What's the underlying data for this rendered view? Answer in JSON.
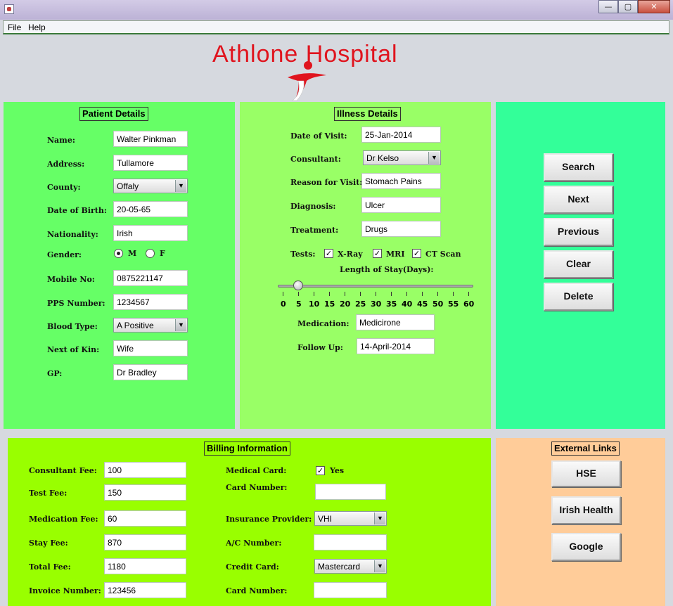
{
  "window": {
    "minimize": "—",
    "maximize": "▢",
    "close": "✕"
  },
  "menu": {
    "file": "File",
    "help": "Help"
  },
  "logo": {
    "text": "Athlone Hospital"
  },
  "patient": {
    "title": "Patient Details",
    "name_label": "Name:",
    "name_value": "Walter Pinkman",
    "address_label": "Address:",
    "address_value": "Tullamore",
    "county_label": "County:",
    "county_value": "Offaly",
    "dob_label": "Date of Birth:",
    "dob_value": "20-05-65",
    "nationality_label": "Nationality:",
    "nationality_value": "Irish",
    "gender_label": "Gender:",
    "gender_m": "M",
    "gender_f": "F",
    "mobile_label": "Mobile No:",
    "mobile_value": "0875221147",
    "pps_label": "PPS Number:",
    "pps_value": "1234567",
    "blood_label": "Blood Type:",
    "blood_value": "A Positive",
    "kin_label": "Next of Kin:",
    "kin_value": "Wife",
    "gp_label": "GP:",
    "gp_value": "Dr Bradley"
  },
  "illness": {
    "title": "Illness Details",
    "visit_label": "Date of Visit:",
    "visit_value": "25-Jan-2014",
    "consultant_label": "Consultant:",
    "consultant_value": "Dr Kelso",
    "reason_label": "Reason for Visit:",
    "reason_value": "Stomach Pains",
    "diagnosis_label": "Diagnosis:",
    "diagnosis_value": "Ulcer",
    "treatment_label": "Treatment:",
    "treatment_value": "Drugs",
    "tests_label": "Tests:",
    "test_xray": "X-Ray",
    "test_mri": "MRI",
    "test_ct": "CT Scan",
    "stay_label": "Length of Stay(Days):",
    "stay_value": 5,
    "ticks": [
      "0",
      "5",
      "10",
      "15",
      "20",
      "25",
      "30",
      "35",
      "40",
      "45",
      "50",
      "55",
      "60"
    ],
    "medication_label": "Medication:",
    "medication_value": "Medicirone",
    "followup_label": "Follow Up:",
    "followup_value": "14-April-2014"
  },
  "actions": {
    "search": "Search",
    "next": "Next",
    "previous": "Previous",
    "clear": "Clear",
    "delete": "Delete"
  },
  "billing": {
    "title": "Billing Information",
    "consultant_fee_label": "Consultant Fee:",
    "consultant_fee_value": "100",
    "test_fee_label": "Test Fee:",
    "test_fee_value": "150",
    "medication_fee_label": "Medication Fee:",
    "medication_fee_value": "60",
    "stay_fee_label": "Stay Fee:",
    "stay_fee_value": "870",
    "total_fee_label": "Total Fee:",
    "total_fee_value": "1180",
    "invoice_label": "Invoice Number:",
    "invoice_value": "123456",
    "medical_card_label": "Medical Card:",
    "medical_card_yes": "Yes",
    "card_number_label": "Card Number:",
    "card_number_value": "",
    "insurance_label": "Insurance Provider:",
    "insurance_value": "VHI",
    "ac_label": "A/C Number:",
    "ac_value": "",
    "credit_label": "Credit Card:",
    "credit_value": "Mastercard",
    "card_number2_label": "Card Number:",
    "card_number2_value": ""
  },
  "links": {
    "title": "External Links",
    "hse": "HSE",
    "irish_health": "Irish Health",
    "google": "Google"
  },
  "colors": {
    "patient_bg": "#66ff66",
    "illness_bg": "#99ff66",
    "actions_bg": "#33ff99",
    "billing_bg": "#99ff00",
    "links_bg": "#ffcc99",
    "logo": "#e0141e"
  }
}
